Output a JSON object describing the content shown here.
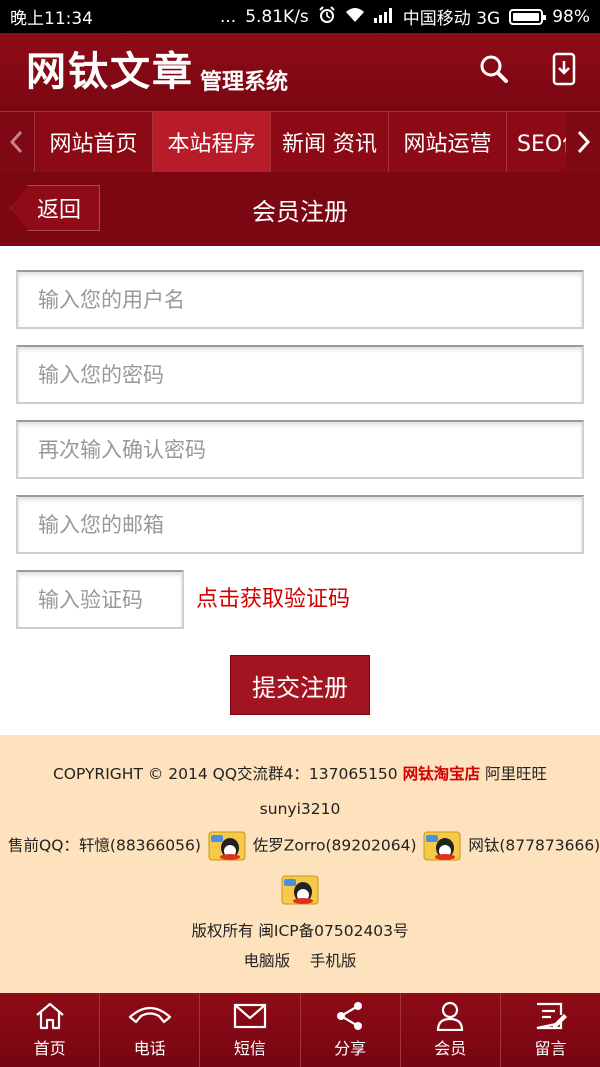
{
  "status_bar": {
    "time": "晚上11:34",
    "dots": "...",
    "speed": "5.81K/s",
    "carrier": "中国移动 3G",
    "battery": "98%"
  },
  "header": {
    "logo_main": "网钛文章",
    "logo_sub": "管理系统",
    "icons": [
      "search-icon",
      "mobile-download-icon"
    ]
  },
  "nav": {
    "items": [
      {
        "label": "网站首页"
      },
      {
        "label": "本站程序"
      },
      {
        "label": "新闻 资讯"
      },
      {
        "label": "网站运营"
      },
      {
        "label": "SEO优"
      }
    ],
    "active_index": 1
  },
  "titlebar": {
    "back_label": "返回",
    "title": "会员注册"
  },
  "form": {
    "username_placeholder": "输入您的用户名",
    "password_placeholder": "输入您的密码",
    "confirm_placeholder": "再次输入确认密码",
    "email_placeholder": "输入您的邮箱",
    "captcha_placeholder": "输入验证码",
    "captcha_link": "点击获取验证码",
    "submit_label": "提交注册"
  },
  "footer": {
    "copyright_prefix": "COPYRIGHT © 2014 QQ交流群4：137065150 ",
    "taobao_shop": "网钛淘宝店",
    "aliwangwang": " 阿里旺旺",
    "ww_id": "sunyi3210",
    "presale_prefix": "售前QQ：",
    "qq1": "轩憶(88366056)",
    "qq2": "佐罗Zorro(89202064)",
    "qq3": "网钛(877873666)",
    "rights": "版权所有  闽ICP备07502403号",
    "pc_version": "电脑版",
    "mobile_version": "手机版"
  },
  "tabbar": {
    "items": [
      {
        "label": "首页",
        "icon": "home-icon"
      },
      {
        "label": "电话",
        "icon": "phone-icon"
      },
      {
        "label": "短信",
        "icon": "mail-icon"
      },
      {
        "label": "分享",
        "icon": "share-icon"
      },
      {
        "label": "会员",
        "icon": "user-icon"
      },
      {
        "label": "留言",
        "icon": "message-icon"
      }
    ]
  },
  "colors": {
    "brand_dark": "#7a0712",
    "brand": "#8e0b17",
    "active_nav": "#b71c28",
    "link_red": "#d40000",
    "footer_bg": "#fde2bd"
  }
}
